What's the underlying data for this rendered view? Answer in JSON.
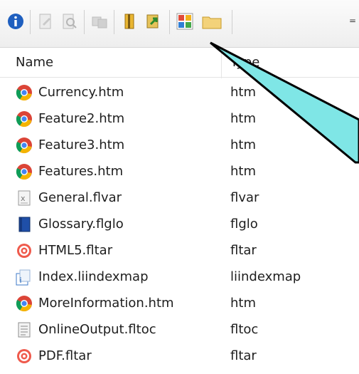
{
  "toolbar": {
    "icons": [
      "info-icon",
      "file-edit-icon",
      "file-search-icon",
      "folder-sync-icon",
      "book-icon",
      "publish-icon",
      "grid-icon",
      "folder-icon"
    ],
    "overflow_glyph": "="
  },
  "columns": {
    "name": "Name",
    "type": "Type"
  },
  "files": [
    {
      "name": "Currency.htm",
      "type": "htm",
      "icon": "chrome-icon"
    },
    {
      "name": "Feature2.htm",
      "type": "htm",
      "icon": "chrome-icon"
    },
    {
      "name": "Feature3.htm",
      "type": "htm",
      "icon": "chrome-icon"
    },
    {
      "name": "Features.htm",
      "type": "htm",
      "icon": "chrome-icon"
    },
    {
      "name": "General.flvar",
      "type": "flvar",
      "icon": "variables-icon"
    },
    {
      "name": "Glossary.flglo",
      "type": "flglo",
      "icon": "glossary-book-icon"
    },
    {
      "name": "HTML5.fltar",
      "type": "fltar",
      "icon": "target-icon"
    },
    {
      "name": "Index.liindexmap",
      "type": "liindexmap",
      "icon": "index-map-icon"
    },
    {
      "name": "MoreInformation.htm",
      "type": "htm",
      "icon": "chrome-icon"
    },
    {
      "name": "OnlineOutput.fltoc",
      "type": "fltoc",
      "icon": "toc-icon"
    },
    {
      "name": "PDF.fltar",
      "type": "fltar",
      "icon": "target-icon"
    }
  ],
  "callout": {
    "fill": "#7fe6e6",
    "stroke": "#000000"
  }
}
